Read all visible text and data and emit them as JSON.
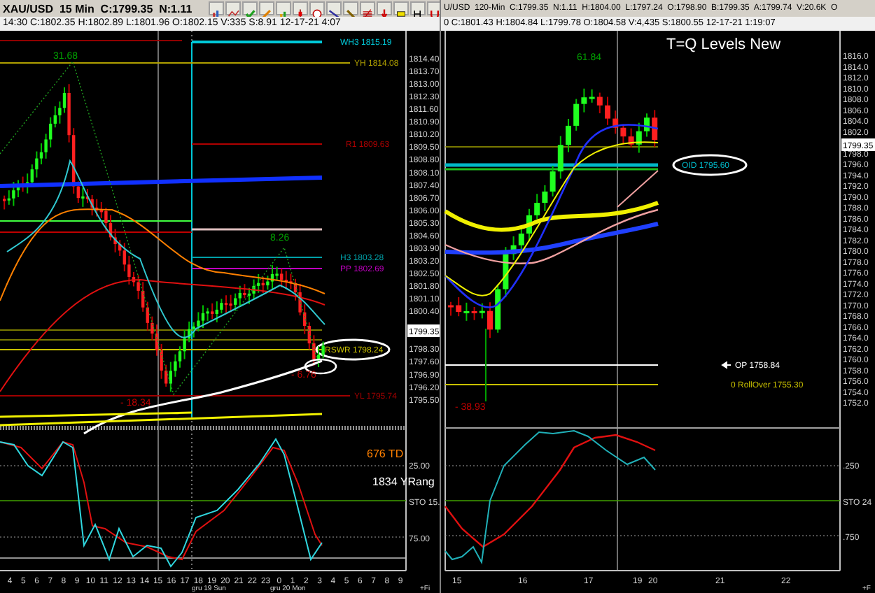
{
  "left_chart": {
    "title": "XAU/USD  15 Min  C:1799.35  N:1.11",
    "info": "14:30 C:1802.35 H:1802.89 L:1801.96 O:1802.15 V:335 S:8.91 12-17-21 4:07",
    "price_axis": [
      "1814.40",
      "1813.70",
      "1813.00",
      "1812.30",
      "1811.60",
      "1810.90",
      "1810.20",
      "1809.50",
      "1808.80",
      "1808.10",
      "1807.40",
      "1806.70",
      "1806.00",
      "1805.30",
      "1804.60",
      "1803.90",
      "1803.20",
      "1802.50",
      "1801.80",
      "1801.10",
      "1800.40",
      "1798.30",
      "1797.60",
      "1796.90",
      "1796.20",
      "1795.50"
    ],
    "current_price": "1799.35",
    "levels": [
      {
        "label": "WH3 1815.19",
        "color": "#00c8d8",
        "circled": false
      },
      {
        "label": "YH 1814.08",
        "color": "#b0a000",
        "circled": false
      },
      {
        "label": "R1 1809.63",
        "color": "#b00000",
        "circled": false
      },
      {
        "label": "H3 1803.28",
        "color": "#00a0a8",
        "circled": false
      },
      {
        "label": "PP 1802.69",
        "color": "#c000c0",
        "circled": false
      },
      {
        "label": "RSWR 1798.24",
        "color": "#c8c000",
        "circled": true
      },
      {
        "label": "YL 1795.74",
        "color": "#a00000",
        "circled": false
      }
    ],
    "annotations": [
      {
        "text": "31.68",
        "color": "#00a000"
      },
      {
        "text": "8.26",
        "color": "#00a000"
      },
      {
        "text": "- 6.76",
        "color": "#c00000"
      },
      {
        "text": "- 18.34",
        "color": "#c00000"
      }
    ],
    "indicator": {
      "labels": [
        "25.00",
        "STO 15.",
        "75.00"
      ],
      "notes": [
        {
          "text": "676 TD",
          "color": "#ff8000"
        },
        {
          "text": "1834 YRang",
          "color": "#ffffff"
        }
      ]
    },
    "time_axis": [
      "4",
      "5",
      "6",
      "7",
      "8",
      "9",
      "10",
      "11",
      "12",
      "13",
      "14",
      "15",
      "16",
      "17",
      "18",
      "19",
      "20",
      "21",
      "22",
      "23",
      "0",
      "1",
      "2",
      "3",
      "4",
      "5",
      "6",
      "7",
      "8",
      "9"
    ],
    "date_labels": [
      "gru 19 Sun",
      "gru 20 Mon"
    ],
    "corner": "+Fi"
  },
  "right_chart": {
    "title": "U/USD  120-Min  C:1799.35  N:1.11  H:1804.00  L:1797.24  O:1798.90  B:1799.35  A:1799.74  V:20.6K  O",
    "info": "0 C:1801.43 H:1804.84 L:1799.78 O:1804.58 V:4,435 S:1800.55 12-17-21 1:19:07",
    "headline": "T=Q Levels New",
    "price_axis": [
      "1816.0",
      "1814.0",
      "1812.0",
      "1810.0",
      "1808.0",
      "1806.0",
      "1804.0",
      "1802.0",
      "1798.0",
      "1796.0",
      "1794.0",
      "1792.0",
      "1790.0",
      "1788.0",
      "1786.0",
      "1784.0",
      "1782.0",
      "1780.0",
      "1778.0",
      "1776.0",
      "1774.0",
      "1772.0",
      "1770.0",
      "1768.0",
      "1766.0",
      "1764.0",
      "1762.0",
      "1760.0",
      "1758.0",
      "1756.0",
      "1754.0",
      "1752.0"
    ],
    "current_price": "1799.35",
    "levels": [
      {
        "label": "OID 1795.60",
        "color": "#00b8c8",
        "circled": true
      },
      {
        "label": "OP 1758.84",
        "color": "#ffffff",
        "circled": false
      },
      {
        "label": "0 RollOver 1755.30",
        "color": "#c8c000",
        "circled": false
      }
    ],
    "annotations": [
      {
        "text": "61.84",
        "color": "#00a000"
      },
      {
        "text": "- 38.93",
        "color": "#c00000"
      }
    ],
    "indicator": {
      "labels": [
        ".250",
        "STO 24",
        ".750"
      ]
    },
    "time_axis": [
      "15",
      "16",
      "17",
      "19",
      "20",
      "21",
      "22"
    ],
    "corner": "+F"
  }
}
